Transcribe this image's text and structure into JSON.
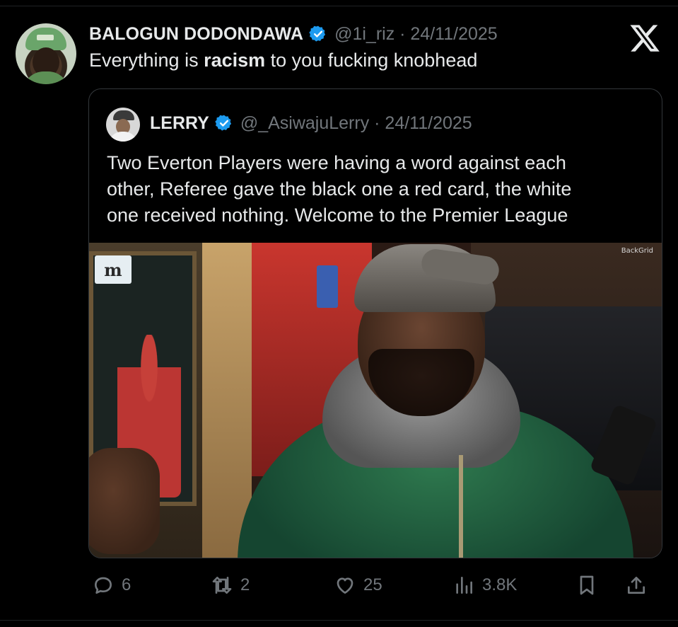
{
  "post": {
    "author_name": "BALOGUN DODONDAWA",
    "author_handle": "@1i_riz · 24/11/2025",
    "text_before": "Everything is ",
    "text_bold": "racism",
    "text_after": " to you fucking knobhead"
  },
  "quote": {
    "author_name": "LERRY",
    "author_handle": "@_AsiwajuLerry · 24/11/2025",
    "text_lines": [
      "Two Everton Players were having a word against each",
      "other, Referee gave the black one a red card, the white",
      "one received nothing. Welcome to the Premier League"
    ],
    "media": {
      "sign_text": "m",
      "watermark": "BackGrid"
    }
  },
  "actions": {
    "replies": "6",
    "reposts": "2",
    "likes": "25",
    "views": "3.8K"
  },
  "colors": {
    "background": "#000000",
    "text": "#e7e9ea",
    "muted": "#71767b",
    "verified": "#1d9bf0",
    "border": "#33373b"
  },
  "icons": [
    "verified-badge-icon",
    "x-logo-icon",
    "reply-icon",
    "repost-icon",
    "like-icon",
    "views-icon",
    "bookmark-icon",
    "share-icon"
  ]
}
